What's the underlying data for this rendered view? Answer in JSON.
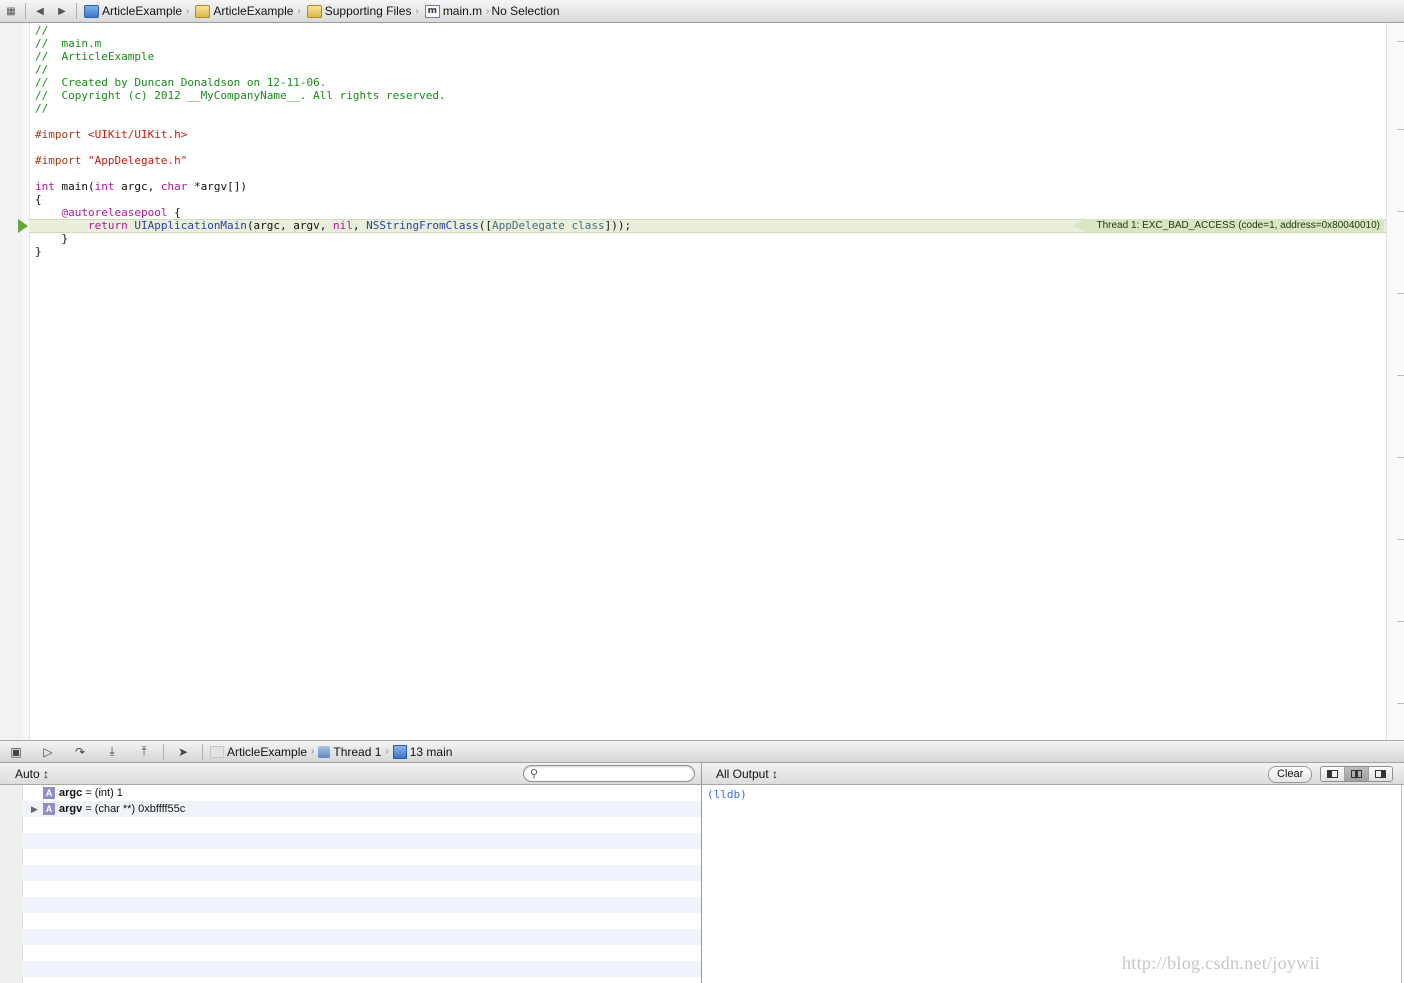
{
  "jumpbar": {
    "crumbs": [
      {
        "label": "ArticleExample",
        "icon": "project-icon"
      },
      {
        "label": "ArticleExample",
        "icon": "folder-icon"
      },
      {
        "label": "Supporting Files",
        "icon": "folder-icon"
      },
      {
        "label": "main.m",
        "icon": "m-file-icon"
      },
      {
        "label": "No Selection",
        "icon": ""
      }
    ]
  },
  "editor": {
    "lines": {
      "l1": "//",
      "l2": "//  main.m",
      "l3": "//  ArticleExample",
      "l4": "//",
      "l5": "//  Created by Duncan Donaldson on 12-11-06.",
      "l6": "//  Copyright (c) 2012 __MyCompanyName__. All rights reserved.",
      "l7": "//",
      "import1_kw": "#import ",
      "import1_path": "<UIKit/UIKit.h>",
      "import2_kw": "#import ",
      "import2_path": "\"AppDelegate.h\"",
      "main_int": "int",
      "main_name": " main(",
      "main_int2": "int",
      "main_argc": " argc, ",
      "main_char": "char",
      "main_argv": " *argv[])",
      "brace_open": "{",
      "pool_kw": "    @autoreleasepool",
      "pool_brace": " {",
      "ret_kw": "        return ",
      "ret_fn": "UIApplicationMain",
      "ret_args": "(argc, argv, ",
      "ret_nil": "nil",
      "ret_comma": ", ",
      "ret_fn2": "NSStringFromClass",
      "ret_open": "([",
      "ret_cls": "AppDelegate",
      "ret_space": " ",
      "ret_class": "class",
      "ret_close": "]));",
      "inner_close": "    }",
      "brace_close": "}"
    },
    "error_banner": "Thread 1: EXC_BAD_ACCESS (code=1, address=0x80040010)"
  },
  "debugbar": {
    "crumbs": [
      {
        "label": "ArticleExample"
      },
      {
        "label": "Thread 1"
      },
      {
        "label": "13 main"
      }
    ]
  },
  "variables": {
    "scope": "Auto ↕",
    "search_placeholder": "",
    "rows": [
      {
        "badge": "A",
        "name": "argc",
        "value": " = (int) 1"
      },
      {
        "badge": "A",
        "name": "argv",
        "value": " = (char **) 0xbffff55c"
      }
    ]
  },
  "console": {
    "filter": "All Output ↕",
    "clear_label": "Clear",
    "prompt": "(lldb)"
  },
  "watermark": "http://blog.csdn.net/joywii"
}
